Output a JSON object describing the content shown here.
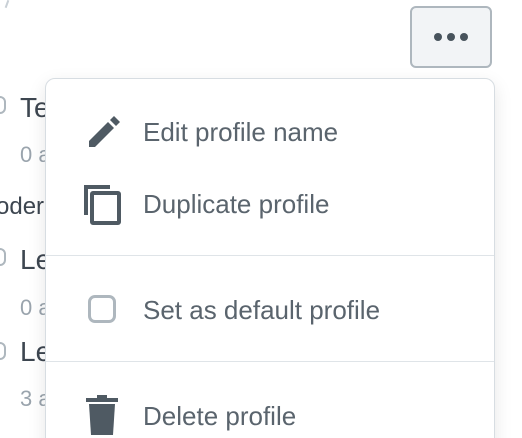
{
  "more_menu_button": {
    "icon": "more-horizontal-icon"
  },
  "background_list": {
    "items": [
      {
        "title": "Te",
        "subtitle": "0 a"
      },
      {
        "category": "oder"
      },
      {
        "title": "Le",
        "subtitle": "0 a"
      },
      {
        "title": "Le",
        "subtitle": "3 a"
      }
    ]
  },
  "profile_menu": {
    "items": [
      {
        "label": "Edit profile name",
        "icon": "pencil-icon"
      },
      {
        "label": "Duplicate profile",
        "icon": "duplicate-icon"
      },
      {
        "label": "Set as default profile",
        "icon": "checkbox-icon"
      },
      {
        "label": "Delete profile",
        "icon": "trash-icon"
      }
    ]
  },
  "colors": {
    "text": "#5a646d",
    "icon": "#4f5a63",
    "border": "#aeb7be"
  }
}
